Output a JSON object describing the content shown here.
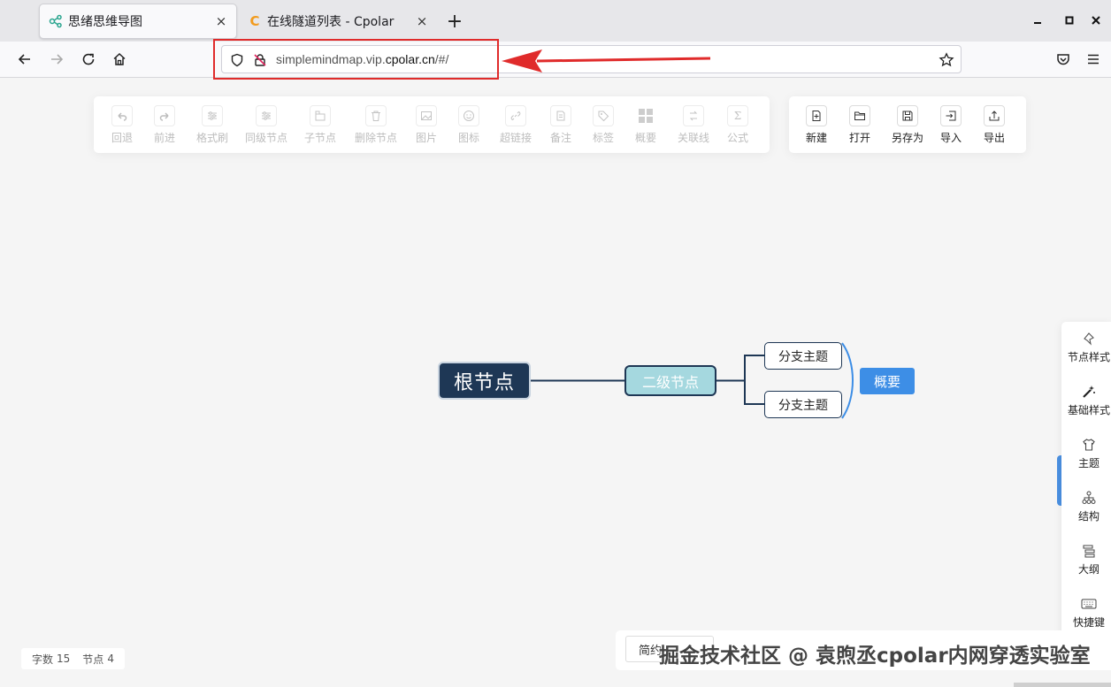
{
  "browser": {
    "tabs": [
      {
        "title": "思绪思维导图",
        "close": "×"
      },
      {
        "title": "在线隧道列表 - Cpolar",
        "close": "×",
        "favicon": "C"
      }
    ],
    "new_tab": "+",
    "url": {
      "prefix": "simplemindmap.vip.",
      "domain": "cpolar.cn",
      "suffix": "/#/"
    },
    "annotation_color": "#e02b2b"
  },
  "toolbar": {
    "edit_tools": [
      {
        "label": "回退",
        "icon": "undo-icon"
      },
      {
        "label": "前进",
        "icon": "redo-icon"
      },
      {
        "label": "格式刷",
        "icon": "format-brush-icon"
      },
      {
        "label": "同级节点",
        "icon": "sibling-node-icon"
      },
      {
        "label": "子节点",
        "icon": "child-node-icon"
      },
      {
        "label": "删除节点",
        "icon": "delete-icon"
      },
      {
        "label": "图片",
        "icon": "image-icon"
      },
      {
        "label": "图标",
        "icon": "emoji-icon"
      },
      {
        "label": "超链接",
        "icon": "link-icon"
      },
      {
        "label": "备注",
        "icon": "note-icon"
      },
      {
        "label": "标签",
        "icon": "tag-icon"
      },
      {
        "label": "概要",
        "icon": "summary-icon"
      },
      {
        "label": "关联线",
        "icon": "association-line-icon"
      },
      {
        "label": "公式",
        "icon": "formula-icon"
      }
    ],
    "file_tools": [
      {
        "label": "新建",
        "icon": "new-file-icon"
      },
      {
        "label": "打开",
        "icon": "open-folder-icon"
      },
      {
        "label": "另存为",
        "icon": "save-as-icon"
      },
      {
        "label": "导入",
        "icon": "import-icon"
      },
      {
        "label": "导出",
        "icon": "export-icon"
      }
    ]
  },
  "mindmap": {
    "root": "根节点",
    "second_level": "二级节点",
    "branches": [
      "分支主题",
      "分支主题"
    ],
    "summary": "概要",
    "colors": {
      "root": "#1e3755",
      "second": "#a5d8df",
      "summary": "#3d8ee6",
      "line": "#1e3755"
    }
  },
  "sidebar": {
    "items": [
      {
        "label": "节点样式",
        "icon": "node-style-icon"
      },
      {
        "label": "基础样式",
        "icon": "magic-wand-icon"
      },
      {
        "label": "主题",
        "icon": "shirt-icon"
      },
      {
        "label": "结构",
        "icon": "structure-icon"
      },
      {
        "label": "大纲",
        "icon": "outline-icon"
      },
      {
        "label": "快捷键",
        "icon": "keyboard-icon"
      }
    ]
  },
  "status": {
    "word_label": "字数",
    "word_count": "15",
    "node_label": "节点",
    "node_count": "4"
  },
  "bottom": {
    "mode_label": "简约",
    "watermark": "掘金技术社区 @ 袁煦丞cpolar内网穿透实验室"
  }
}
